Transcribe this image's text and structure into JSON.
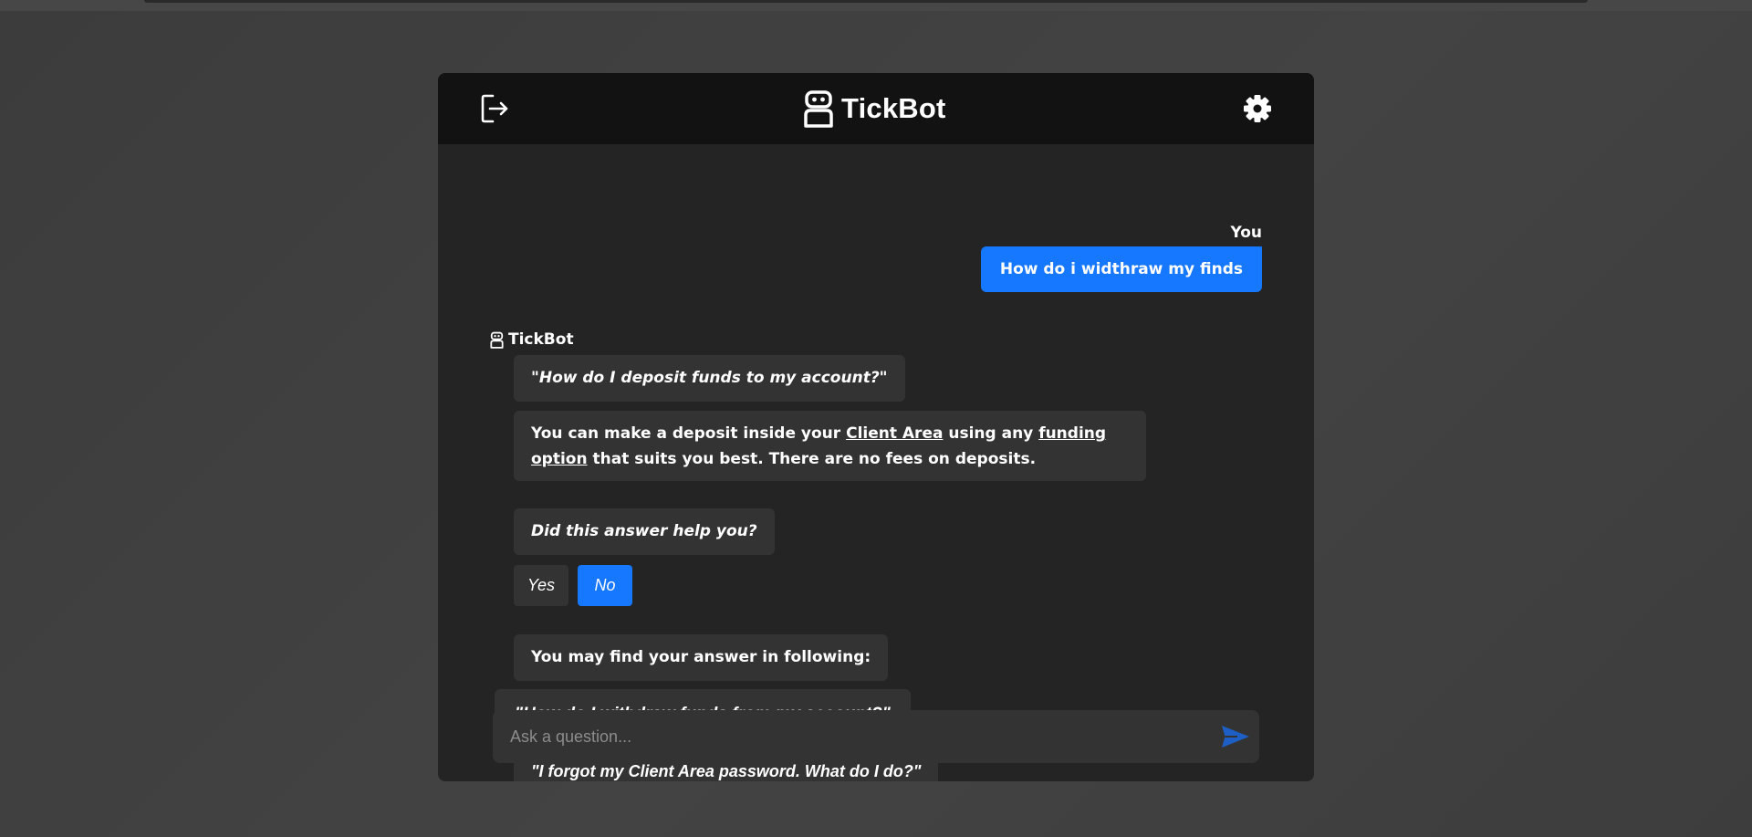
{
  "app": {
    "name": "TickBot",
    "accent_color": "#1677ff",
    "header_icons": {
      "logout": "logout-icon",
      "logo": "robot-icon",
      "settings": "gear-icon"
    }
  },
  "conversation": {
    "user_label": "You",
    "user_message": "How do i widthraw my finds",
    "bot_label": "TickBot",
    "matched_question": "\"How do I deposit funds to my account?\"",
    "answer": {
      "text_before_link1": "You can make a deposit inside your ",
      "link1": "Client Area",
      "text_between": " using any ",
      "link2": "funding option",
      "text_after": " that suits you best. There are no fees on deposits."
    },
    "feedback_question": "Did this answer help you?",
    "feedback_yes": "Yes",
    "feedback_no": "No",
    "feedback_selected": "No",
    "suggestions_intro": "You may find your answer in following:",
    "suggestions": [
      "\"How do I withdraw funds from my account?\"",
      "\"I forgot my Client Area password. What do I do?\""
    ]
  },
  "composer": {
    "placeholder": "Ask a question...",
    "value": "",
    "send_icon": "send-icon"
  }
}
